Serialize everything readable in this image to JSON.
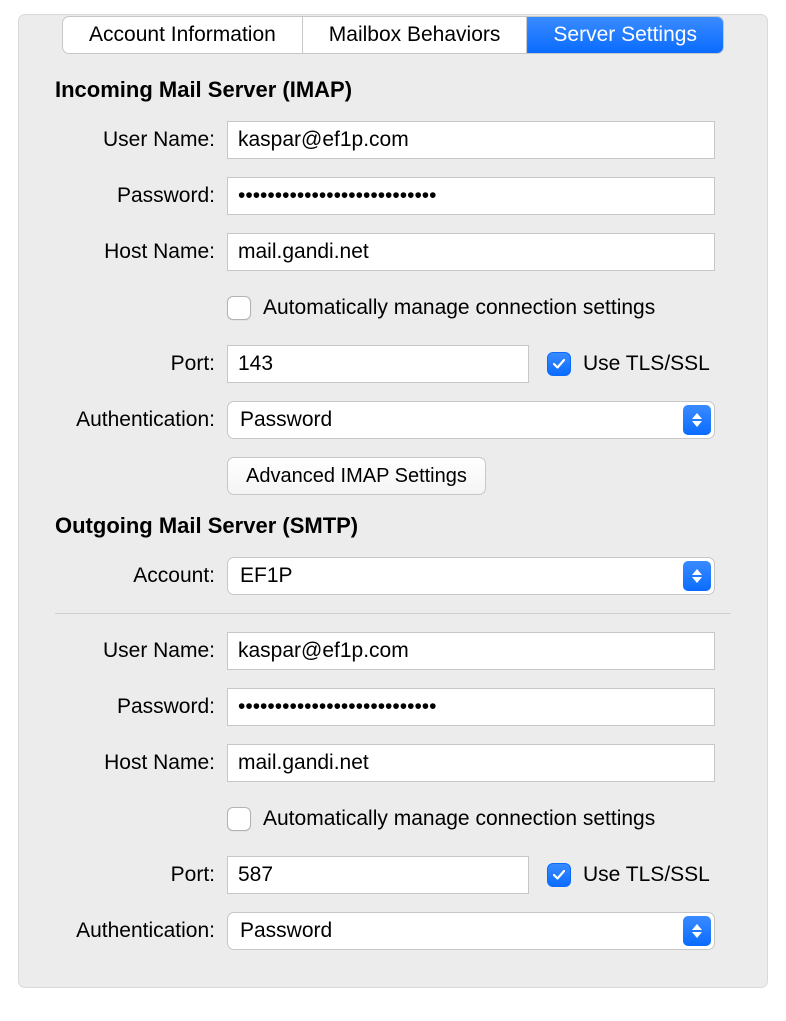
{
  "tabs": {
    "account_info": "Account Information",
    "mailbox_behaviors": "Mailbox Behaviors",
    "server_settings": "Server Settings"
  },
  "labels": {
    "user_name": "User Name:",
    "password": "Password:",
    "host_name": "Host Name:",
    "port": "Port:",
    "authentication": "Authentication:",
    "account": "Account:",
    "auto_manage": "Automatically manage connection settings",
    "use_tls": "Use TLS/SSL",
    "advanced_imap": "Advanced IMAP Settings"
  },
  "sections": {
    "incoming_title": "Incoming Mail Server (IMAP)",
    "outgoing_title": "Outgoing Mail Server (SMTP)"
  },
  "incoming": {
    "user_name": "kaspar@ef1p.com",
    "password": "•••••••••••••••••••••••••••",
    "host_name": "mail.gandi.net",
    "auto_manage_checked": false,
    "port": "143",
    "use_tls_checked": true,
    "authentication": "Password"
  },
  "outgoing": {
    "account": "EF1P",
    "user_name": "kaspar@ef1p.com",
    "password": "•••••••••••••••••••••••••••",
    "host_name": "mail.gandi.net",
    "auto_manage_checked": false,
    "port": "587",
    "use_tls_checked": true,
    "authentication": "Password"
  }
}
